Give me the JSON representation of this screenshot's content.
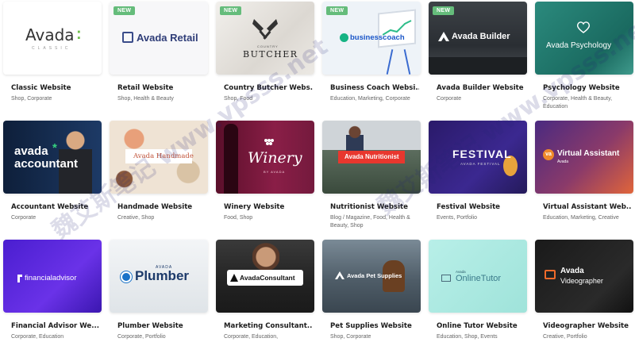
{
  "badge_label": "NEW",
  "watermark": "魏艾斯笔记 www.vpsss.net",
  "cards": [
    {
      "title": "Classic Website",
      "tags": "Shop, Corporate",
      "thumb_text": "Avada",
      "thumb_sub": "CLASSIC",
      "is_new": false
    },
    {
      "title": "Retail Website",
      "tags": "Shop, Health & Beauty",
      "thumb_text": "Avada Retail",
      "is_new": true
    },
    {
      "title": "Country Butcher Webs...",
      "tags": "Shop, Food",
      "thumb_text": "BUTCHER",
      "thumb_sub": "COUNTRY",
      "is_new": true
    },
    {
      "title": "Business Coach Websi...",
      "tags": "Education, Marketing, Corporate",
      "thumb_text": "businesscoach",
      "is_new": true
    },
    {
      "title": "Avada Builder Website",
      "tags": "Corporate",
      "thumb_text": "Avada Builder",
      "is_new": true
    },
    {
      "title": "Psychology Website",
      "tags": "Corporate, Health & Beauty, Education",
      "thumb_text": "Avada Psychology",
      "is_new": false
    },
    {
      "title": "Accountant Website",
      "tags": "Corporate",
      "thumb_text": "avada",
      "thumb_sub": "accountant",
      "is_new": false
    },
    {
      "title": "Handmade Website",
      "tags": "Creative, Shop",
      "thumb_text": "Avada Handmade",
      "is_new": false
    },
    {
      "title": "Winery Website",
      "tags": "Food, Shop",
      "thumb_text": "Winery",
      "thumb_sub": "BY AVADA",
      "is_new": false
    },
    {
      "title": "Nutritionist Website",
      "tags": "Blog / Magazine, Food, Health & Beauty, Shop",
      "thumb_text": "Avada Nutritionist",
      "is_new": false
    },
    {
      "title": "Festival Website",
      "tags": "Events, Portfolio",
      "thumb_text": "FESTIVAL",
      "thumb_sub": "AVADA FESTIVAL",
      "is_new": false
    },
    {
      "title": "Virtual Assistant Web...",
      "tags": "Education, Marketing, Creative",
      "thumb_text": "Virtual Assistant",
      "thumb_sub": "Avada",
      "is_new": false
    },
    {
      "title": "Financial Advisor We...",
      "tags": "Corporate, Education",
      "thumb_text": "financialadvisor",
      "is_new": false
    },
    {
      "title": "Plumber Website",
      "tags": "Corporate, Portfolio",
      "thumb_text": "Plumber",
      "thumb_sub": "AVADA",
      "is_new": false
    },
    {
      "title": "Marketing Consultant...",
      "tags": "Corporate, Education,",
      "thumb_text": "AvadaConsultant",
      "is_new": false
    },
    {
      "title": "Pet Supplies Website",
      "tags": "Shop, Corporate",
      "thumb_text": "Avada Pet Supplies",
      "is_new": false
    },
    {
      "title": "Online Tutor Website",
      "tags": "Education, Shop, Events",
      "thumb_text": "OnlineTutor",
      "thumb_sub": "Avada",
      "is_new": false
    },
    {
      "title": "Videographer Website",
      "tags": "Creative, Portfolio",
      "thumb_text": "Avada",
      "thumb_sub": "Videographer",
      "is_new": false
    }
  ]
}
